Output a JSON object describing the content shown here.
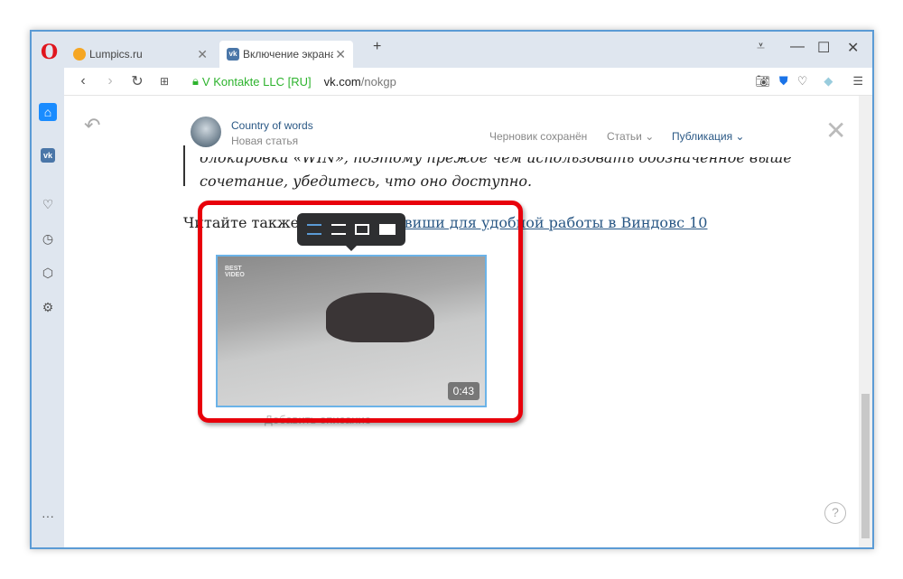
{
  "browser": {
    "tabs": [
      {
        "title": "Lumpics.ru"
      },
      {
        "title": "Включение экрана блокировки"
      }
    ],
    "address": {
      "security": "V Kontakte LLC [RU]",
      "domain": "vk.com",
      "path": "/nokgp"
    }
  },
  "header": {
    "author": "Country of words",
    "subtitle": "Новая статья",
    "draft_status": "Черновик сохранён",
    "articles": "Статьи",
    "publish": "Публикация"
  },
  "article": {
    "quote_line1": "блокировки «WIN», поэтому прежде чем использовать обозначенное выше",
    "quote_line2": "сочетание, убедитесь, что оно доступно.",
    "read_also_prefix": "Читайте также: ",
    "read_also_link": "Горячие клавиши для удобной работы в Виндовс 10",
    "video_duration": "0:43",
    "video_watermark": "BEST VIDEO",
    "caption_placeholder": "Добавить описание"
  },
  "help": "?",
  "colors": {
    "highlight": "#e8000b",
    "accent": "#4a76a8",
    "link": "#2a5885"
  }
}
